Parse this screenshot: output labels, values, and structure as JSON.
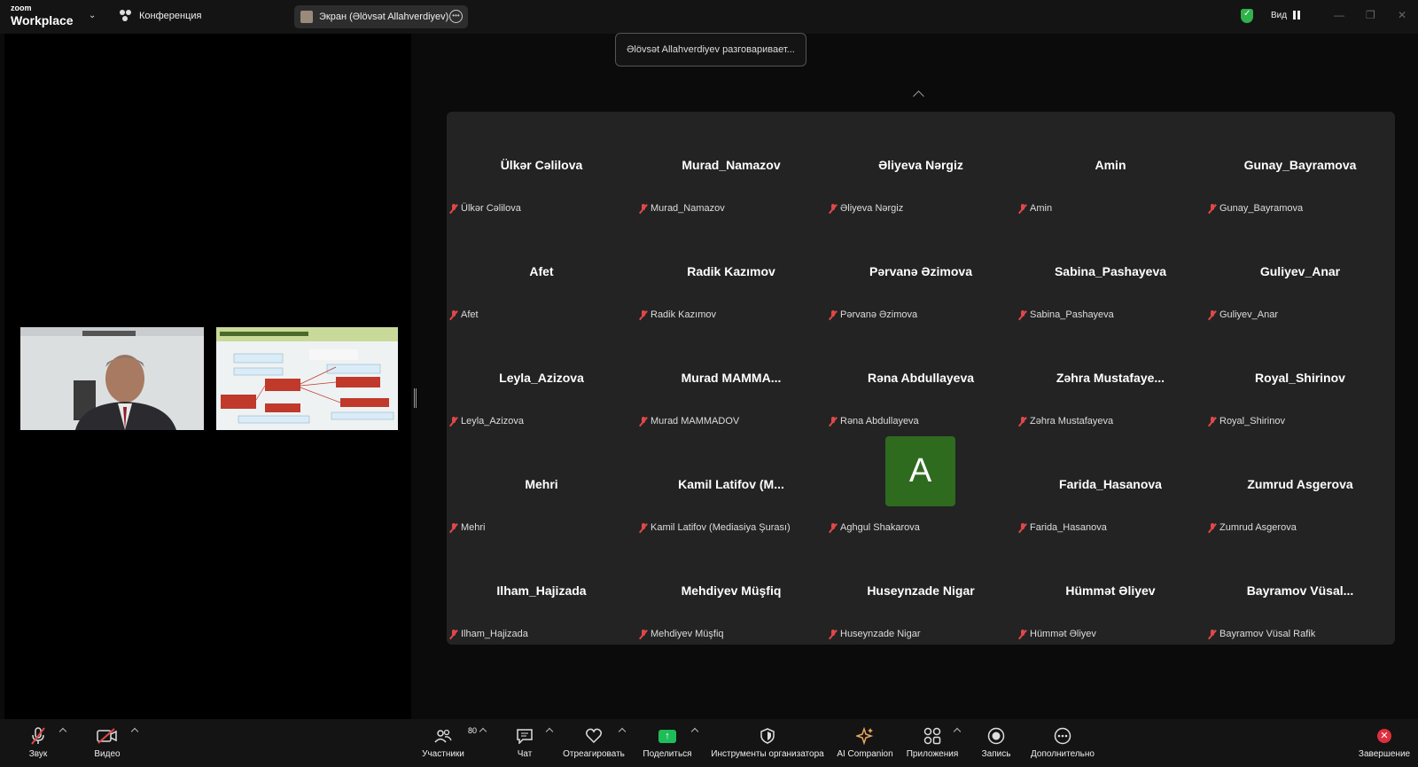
{
  "titlebar": {
    "logo_small": "zoom",
    "logo_big": "Workplace",
    "conference_label": "Конференция",
    "screen_share_label": "Экран (Əlövsət Allahverdiyev)",
    "view_label": "Вид"
  },
  "speaking_banner": "Əlövsət Allahverdiyev разговаривает...",
  "participants": [
    {
      "display": "Ülkər Cəlilova",
      "name": "Ülkər Cəlilova"
    },
    {
      "display": "Murad_Namazov",
      "name": "Murad_Namazov"
    },
    {
      "display": "Əliyeva Nərgiz",
      "name": "Əliyeva Nərgiz"
    },
    {
      "display": "Amin",
      "name": "Amin"
    },
    {
      "display": "Gunay_Bayramova",
      "name": "Gunay_Bayramova"
    },
    {
      "display": "Afet",
      "name": "Afet"
    },
    {
      "display": "Radik Kazımov",
      "name": "Radik Kazımov"
    },
    {
      "display": "Pərvanə Əzimova",
      "name": "Pərvanə Əzimova"
    },
    {
      "display": "Sabina_Pashayeva",
      "name": "Sabina_Pashayeva"
    },
    {
      "display": "Guliyev_Anar",
      "name": "Guliyev_Anar"
    },
    {
      "display": "Leyla_Azizova",
      "name": "Leyla_Azizova"
    },
    {
      "display": "Murad  MAMMA...",
      "name": "Murad MAMMADOV"
    },
    {
      "display": "Rəna Abdullayeva",
      "name": "Rəna Abdullayeva"
    },
    {
      "display": "Zəhra  Mustafaye...",
      "name": "Zəhra Mustafayeva"
    },
    {
      "display": "Royal_Shirinov",
      "name": "Royal_Shirinov"
    },
    {
      "display": "Mehri",
      "name": "Mehri"
    },
    {
      "display": "Kamil  Latifov  (M...",
      "name": "Kamil Latifov (Mediasiya Şurası)"
    },
    {
      "display": "",
      "avatar_letter": "A",
      "name": "Aghgul Shakarova"
    },
    {
      "display": "Farida_Hasanova",
      "name": "Farida_Hasanova"
    },
    {
      "display": "Zumrud Asgerova",
      "name": "Zumrud Asgerova"
    },
    {
      "display": "Ilham_Hajizada",
      "name": "Ilham_Hajizada"
    },
    {
      "display": "Mehdiyev Müşfiq",
      "name": "Mehdiyev Müşfiq"
    },
    {
      "display": "Huseynzade Nigar",
      "name": "Huseynzade Nigar"
    },
    {
      "display": "Hümmət Əliyev",
      "name": "Hümmət Əliyev"
    },
    {
      "display": "Bayramov  Vüsal...",
      "name": "Bayramov Vüsal Rafik"
    }
  ],
  "toolbar": {
    "audio": "Звук",
    "video": "Видео",
    "participants": "Участники",
    "participants_count": "80",
    "chat": "Чат",
    "react": "Отреагировать",
    "share": "Поделиться",
    "host_tools": "Инструменты организатора",
    "ai": "AI Companion",
    "apps": "Приложения",
    "record": "Запись",
    "more": "Дополнительно",
    "end": "Завершение"
  },
  "colors": {
    "avatar_bg": "#2e6b1f",
    "share_green": "#1fbd59",
    "muted_red": "#e04848",
    "end_red": "#e02e3e"
  }
}
